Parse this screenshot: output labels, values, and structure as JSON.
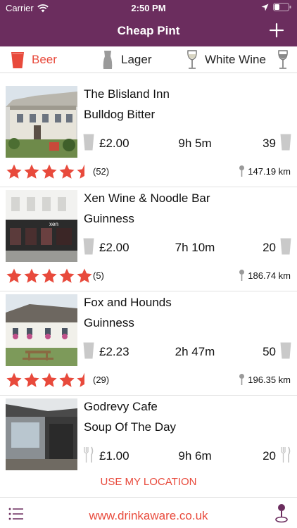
{
  "status_bar": {
    "carrier": "Carrier",
    "time": "2:50 PM"
  },
  "nav": {
    "title": "Cheap Pint",
    "add_icon": "plus-icon"
  },
  "tabs": [
    {
      "label": "Beer",
      "icon": "pint-glass-icon",
      "active": true
    },
    {
      "label": "Lager",
      "icon": "lager-glass-icon",
      "active": false
    },
    {
      "label": "White Wine",
      "icon": "wine-glass-icon",
      "active": false
    },
    {
      "label": "",
      "icon": "wine-glass-icon",
      "active": false
    }
  ],
  "pubs": [
    {
      "name": "The Blisland Inn",
      "drink": "Bulldog Bitter",
      "price": "£2.00",
      "ago": "9h 5m",
      "count": "39",
      "rating": 4.5,
      "reviews": "(52)",
      "distance": "147.19 km",
      "icon": "pint-glass-icon"
    },
    {
      "name": "Xen Wine & Noodle Bar",
      "drink": "Guinness",
      "price": "£2.00",
      "ago": "7h 10m",
      "count": "20",
      "rating": 5,
      "reviews": "(5)",
      "distance": "186.74 km",
      "icon": "pint-glass-icon"
    },
    {
      "name": "Fox and Hounds",
      "drink": "Guinness",
      "price": "£2.23",
      "ago": "2h 47m",
      "count": "50",
      "rating": 4.5,
      "reviews": "(29)",
      "distance": "196.35 km",
      "icon": "pint-glass-icon"
    },
    {
      "name": "Godrevy Cafe",
      "drink": "Soup Of The Day",
      "price": "£1.00",
      "ago": "9h 6m",
      "count": "20",
      "rating": 0,
      "reviews": "",
      "distance": "",
      "icon": "fork-knife-icon"
    }
  ],
  "use_location": "USE MY LOCATION",
  "footer": {
    "link": "www.drinkaware.co.uk",
    "menu_icon": "list-icon",
    "map_icon": "map-pin-icon"
  },
  "colors": {
    "brand": "#6b2d5e",
    "accent": "#e84a3c"
  }
}
